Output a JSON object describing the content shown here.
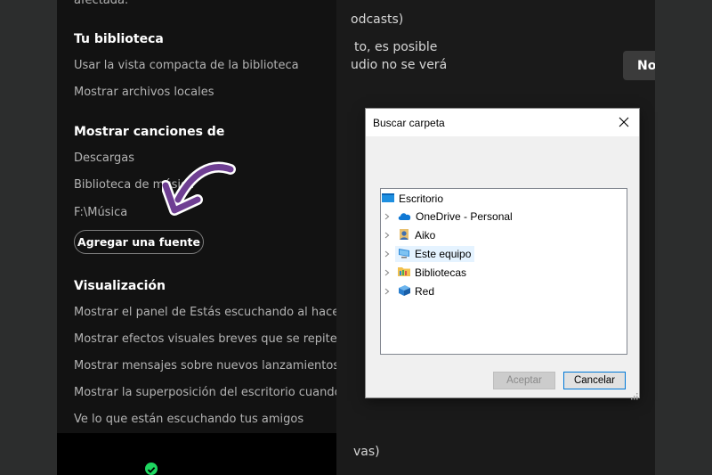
{
  "settings": {
    "cut_text": "afectada.",
    "library_heading": "Tu biblioteca",
    "library_items": [
      "Usar la vista compacta de la biblioteca",
      "Mostrar archivos locales"
    ],
    "songs_heading": "Mostrar canciones de",
    "songs_items": [
      "Descargas",
      "Biblioteca de música",
      "F:\\Música"
    ],
    "add_source_label": "Agregar una fuente",
    "display_heading": "Visualización",
    "display_items": [
      "Mostrar el panel de Estás escuchando al hacer clic",
      "Mostrar efectos visuales breves que se repiten en",
      "Mostrar mensajes sobre nuevos lanzamientos",
      "Mostrar la superposición del escritorio cuando se u",
      "Ve lo que están escuchando tus amigos"
    ]
  },
  "background": {
    "line1": "odcasts)",
    "line2": "to, es posible",
    "line3": "udio no se verá",
    "button_label": "No",
    "line4": "vas)"
  },
  "dialog": {
    "title": "Buscar carpeta",
    "tree": [
      {
        "label": "Escritorio",
        "icon": "desktop-icon"
      },
      {
        "label": "OneDrive - Personal",
        "icon": "cloud-icon"
      },
      {
        "label": "Aiko",
        "icon": "user-icon"
      },
      {
        "label": "Este equipo",
        "icon": "computer-icon",
        "selected": true
      },
      {
        "label": "Bibliotecas",
        "icon": "library-folder-icon"
      },
      {
        "label": "Red",
        "icon": "network-icon"
      }
    ],
    "accept_label": "Aceptar",
    "cancel_label": "Cancelar"
  },
  "colors": {
    "spotify_green": "#1ed760",
    "arrow_purple": "#6f3f93",
    "selection": "#e5f3ff"
  }
}
